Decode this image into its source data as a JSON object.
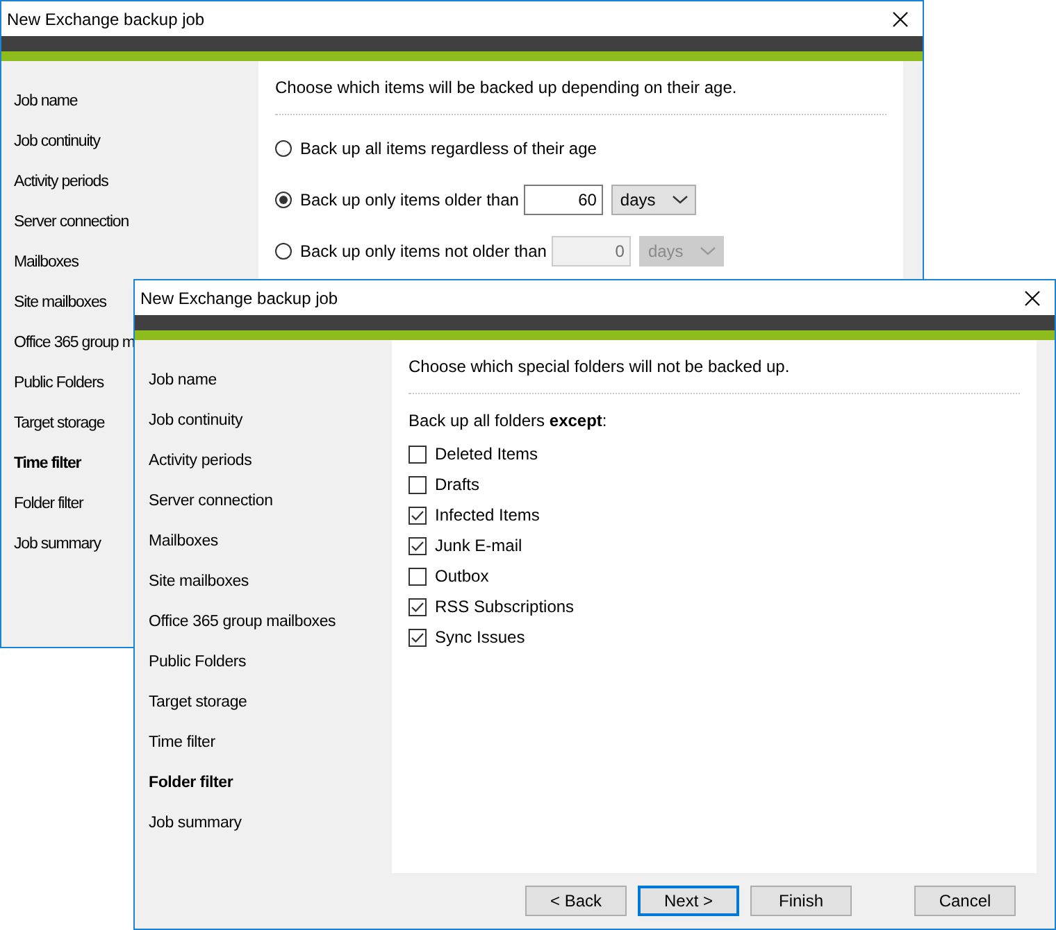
{
  "windows": [
    {
      "title": "New Exchange backup job",
      "sidebar": {
        "items": [
          {
            "label": "Job name",
            "selected": false
          },
          {
            "label": "Job continuity",
            "selected": false
          },
          {
            "label": "Activity periods",
            "selected": false
          },
          {
            "label": "Server connection",
            "selected": false
          },
          {
            "label": "Mailboxes",
            "selected": false
          },
          {
            "label": "Site mailboxes",
            "selected": false
          },
          {
            "label": "Office 365 group m",
            "selected": false
          },
          {
            "label": "Public Folders",
            "selected": false
          },
          {
            "label": "Target storage",
            "selected": false
          },
          {
            "label": "Time filter",
            "selected": true
          },
          {
            "label": "Folder filter",
            "selected": false
          },
          {
            "label": "Job summary",
            "selected": false
          }
        ]
      },
      "content": {
        "kind": "age_filter",
        "intro": "Choose which items will be backed up depending on their age.",
        "options": [
          {
            "label": "Back up all items regardless of their age",
            "selected": false
          },
          {
            "label": "Back up only items older than",
            "selected": true,
            "amount": {
              "value": "60",
              "unit": "days",
              "disabled": false
            }
          },
          {
            "label": "Back up only items not older than",
            "selected": false,
            "amount": {
              "value": "0",
              "unit": "days",
              "disabled": true
            }
          }
        ]
      }
    },
    {
      "title": "New Exchange backup job",
      "sidebar": {
        "items": [
          {
            "label": "Job name",
            "selected": false
          },
          {
            "label": "Job continuity",
            "selected": false
          },
          {
            "label": "Activity periods",
            "selected": false
          },
          {
            "label": "Server connection",
            "selected": false
          },
          {
            "label": "Mailboxes",
            "selected": false
          },
          {
            "label": "Site mailboxes",
            "selected": false
          },
          {
            "label": "Office 365 group mailboxes",
            "selected": false
          },
          {
            "label": "Public Folders",
            "selected": false
          },
          {
            "label": "Target storage",
            "selected": false
          },
          {
            "label": "Time filter",
            "selected": false
          },
          {
            "label": "Folder filter",
            "selected": true
          },
          {
            "label": "Job summary",
            "selected": false
          }
        ]
      },
      "content": {
        "kind": "folder_filter",
        "intro": "Choose which special folders will not be backed up.",
        "lead": "Back up all folders **except**:",
        "folders": [
          {
            "label": "Deleted Items",
            "checked": false
          },
          {
            "label": "Drafts",
            "checked": false
          },
          {
            "label": "Infected Items",
            "checked": true
          },
          {
            "label": "Junk E-mail",
            "checked": true
          },
          {
            "label": "Outbox",
            "checked": false
          },
          {
            "label": "RSS Subscriptions",
            "checked": true
          },
          {
            "label": "Sync Issues",
            "checked": true
          }
        ]
      },
      "buttons": [
        {
          "label": "< Back",
          "default": false
        },
        {
          "label": "Next >",
          "default": true
        },
        {
          "label": "Finish",
          "default": false
        },
        {
          "label": "Cancel",
          "default": false
        }
      ]
    }
  ]
}
